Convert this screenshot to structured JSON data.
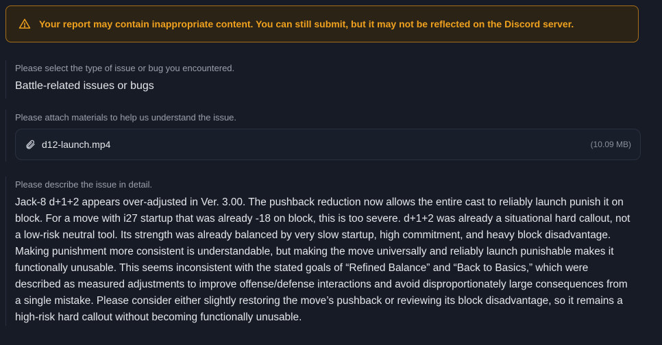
{
  "warning": {
    "icon": "warning-triangle-icon",
    "text": "Your report may contain inappropriate content. You can still submit, but it may not be reflected on the Discord server."
  },
  "issue_type": {
    "label": "Please select the type of issue or bug you encountered.",
    "value": "Battle-related issues or bugs"
  },
  "attachments": {
    "label": "Please attach materials to help us understand the issue.",
    "file": {
      "icon": "paperclip-icon",
      "name": "d12-launch.mp4",
      "size": "(10.09 MB)"
    }
  },
  "description": {
    "label": "Please describe the issue in detail.",
    "text": "Jack-8 d+1+2 appears over-adjusted in Ver. 3.00. The pushback reduction now allows the entire cast to reliably launch punish it on block. For a move with i27 startup that was already -18 on block, this is too severe. d+1+2 was already a situational hard callout, not a low-risk neutral tool. Its strength was already balanced by very slow startup, high commitment, and heavy block disadvantage. Making punishment more consistent is understandable, but making the move universally and reliably launch punishable makes it functionally unusable. This seems inconsistent with the stated goals of “Refined Balance” and “Back to Basics,” which were described as measured adjustments to improve offense/defense interactions and avoid disproportionately large consequences from a single mistake. Please consider either slightly restoring the move’s pushback or reviewing its block disadvantage, so it remains a high-risk hard callout without becoming functionally unusable."
  },
  "colors": {
    "background": "#161b26",
    "warning_text": "#f0a21f",
    "warning_border": "#a86f1a"
  }
}
